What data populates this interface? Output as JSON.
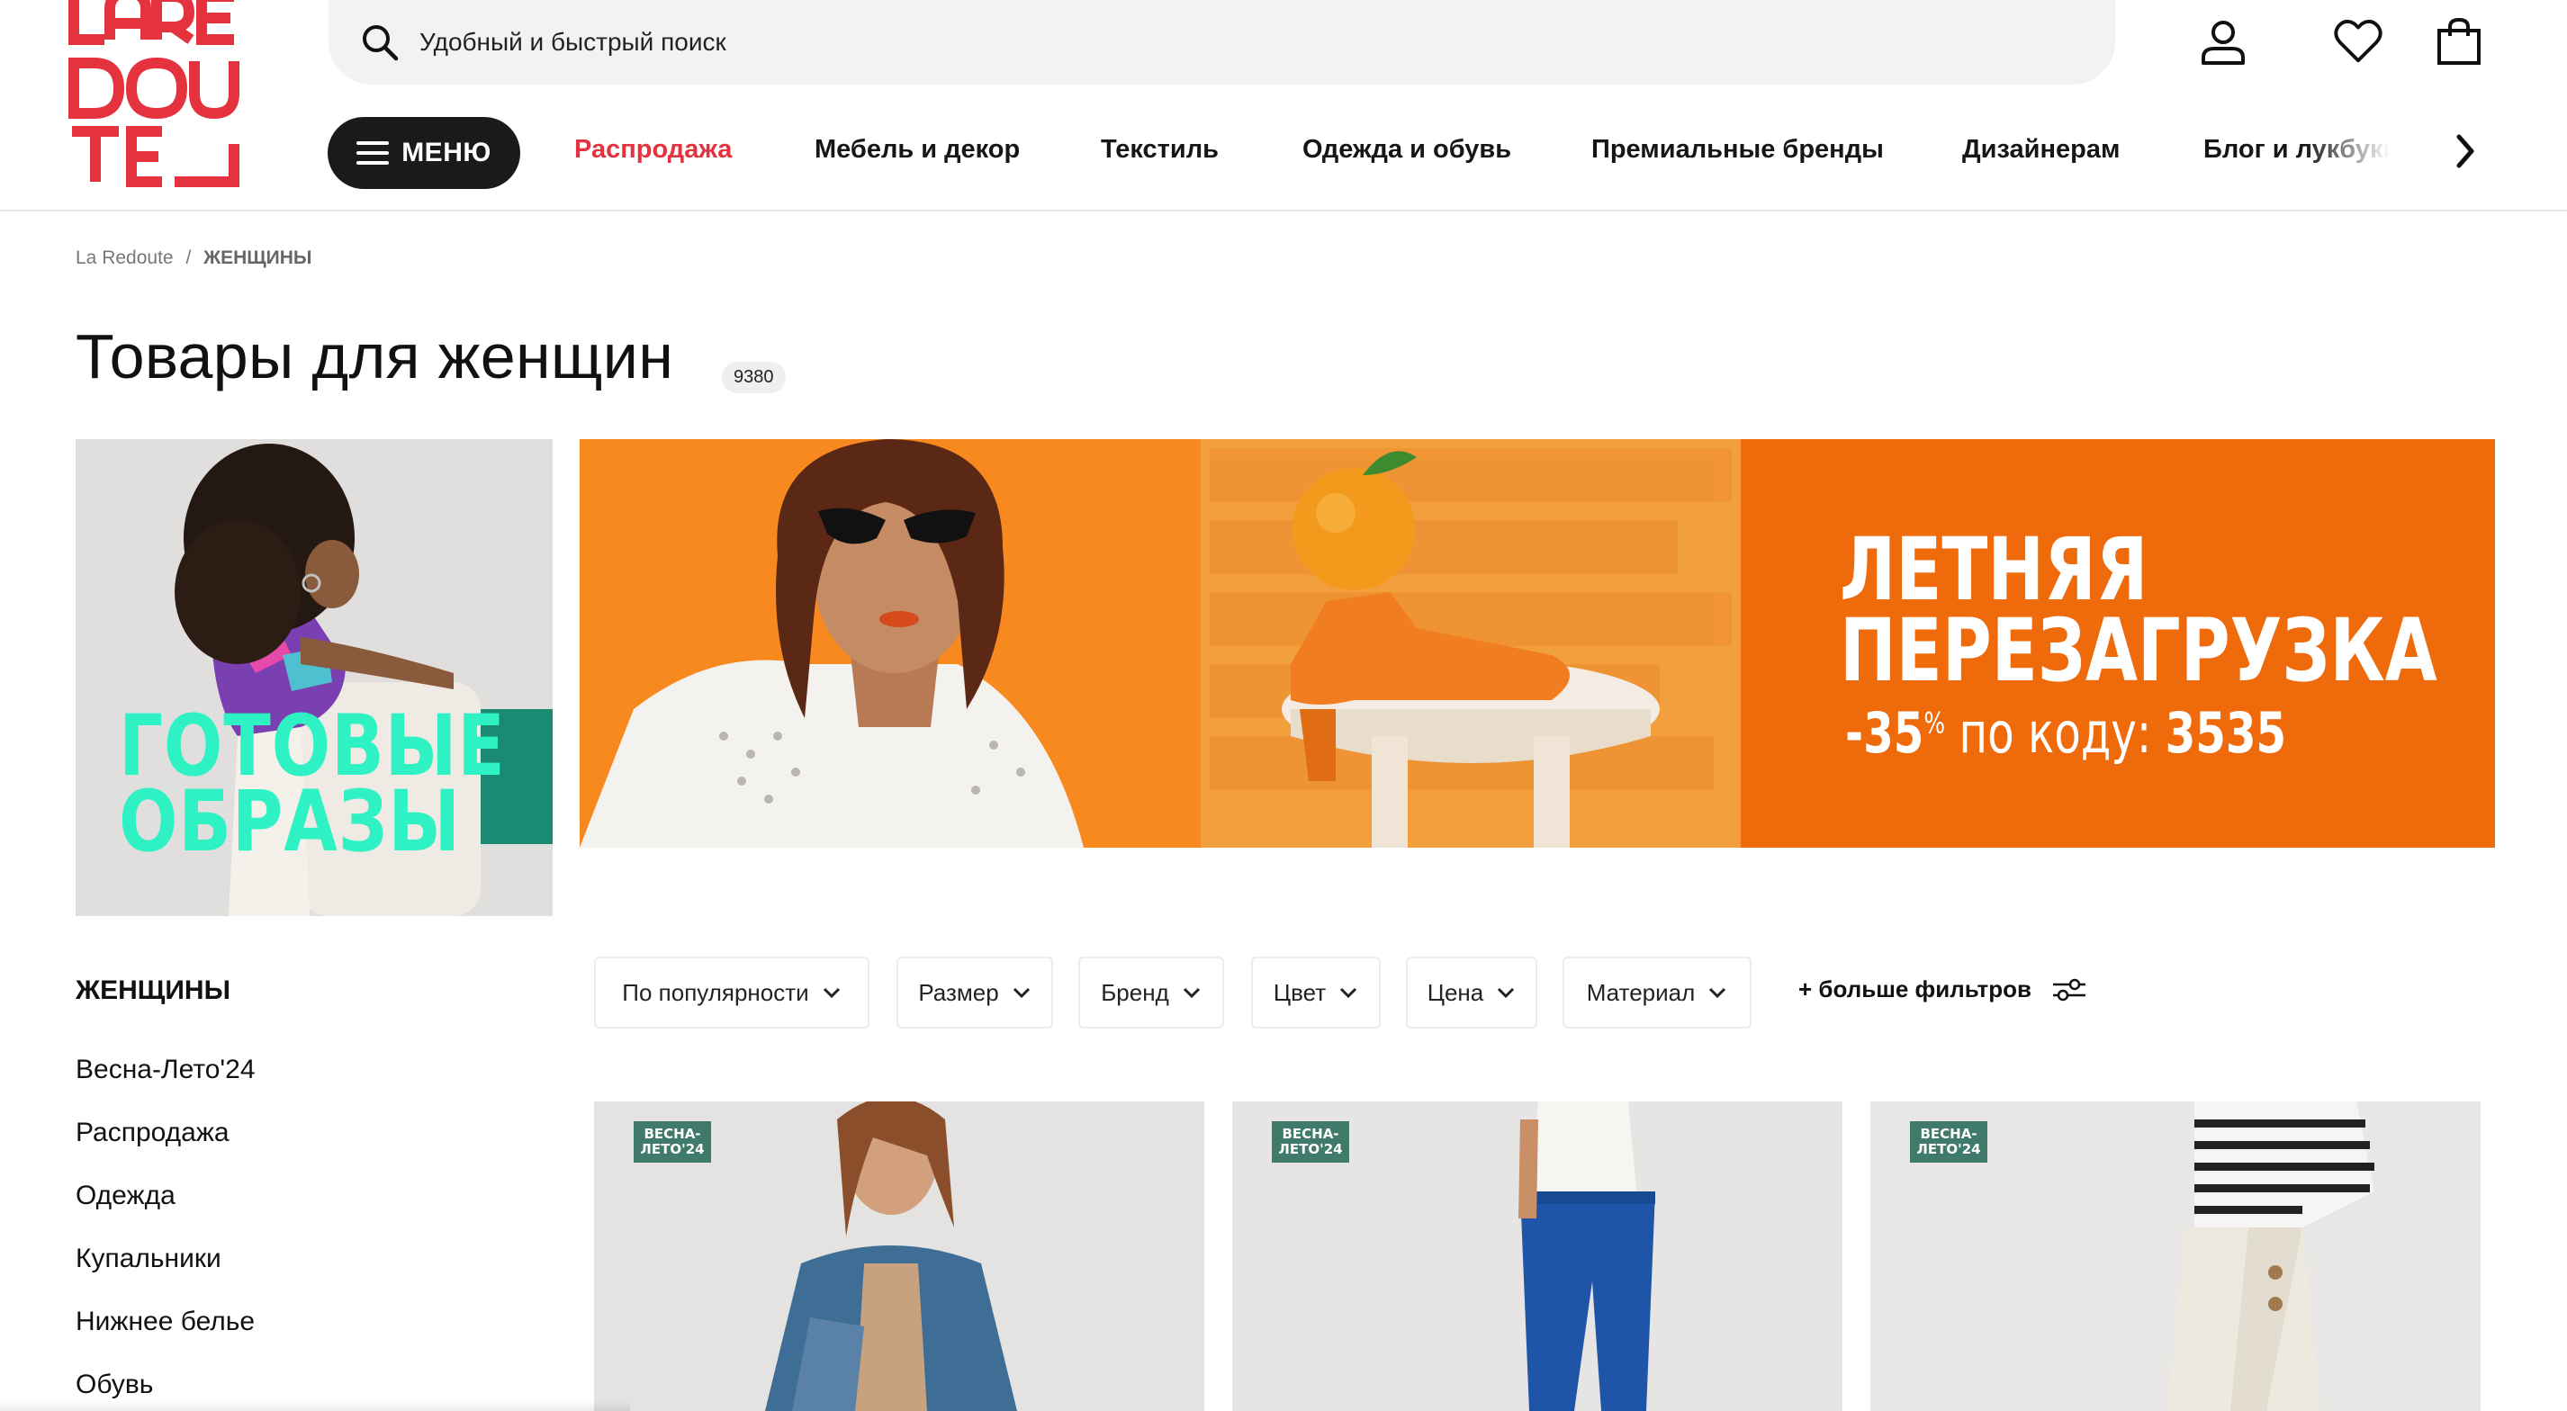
{
  "brand": {
    "logo_text": "LAREDOUTE",
    "accent_color": "#e4333f"
  },
  "search": {
    "placeholder": "Удобный и быстрый поиск"
  },
  "header_icons": [
    "account-icon",
    "heart-icon",
    "bag-icon"
  ],
  "nav": {
    "menu_label": "МЕНЮ",
    "items": [
      {
        "label": "Распродажа",
        "color": "#e4333f"
      },
      {
        "label": "Мебель и декор"
      },
      {
        "label": "Текстиль"
      },
      {
        "label": "Одежда и обувь"
      },
      {
        "label": "Премиальные бренды"
      },
      {
        "label": "Дизайнерам"
      },
      {
        "label": "Блог и лукбуки"
      }
    ]
  },
  "breadcrumb": {
    "root": "La Redoute",
    "separator": "/",
    "current": "ЖЕНЩИНЫ"
  },
  "page": {
    "title": "Товары для женщин",
    "count": "9380"
  },
  "banners": {
    "left": {
      "line1": "ГОТОВЫЕ",
      "line2": "ОБРАЗЫ"
    },
    "main": {
      "title_line1": "ЛЕТНЯЯ",
      "title_line2": "ПЕРЕЗАГРУЗКА",
      "discount": "-35",
      "percent": "%",
      "code_text": "по коду:",
      "code": "3535",
      "bg_colors": [
        "#f7891f",
        "#f2a03e",
        "#ef6a0a"
      ]
    }
  },
  "sidebar": {
    "title": "ЖЕНЩИНЫ",
    "items": [
      "Весна-Лето'24",
      "Распродажа",
      "Одежда",
      "Купальники",
      "Нижнее белье",
      "Обувь"
    ]
  },
  "filters": {
    "items": [
      "По популярности",
      "Размер",
      "Бренд",
      "Цвет",
      "Цена",
      "Материал"
    ],
    "more_label": "+ больше фильтров"
  },
  "products": [
    {
      "badge": "ВЕСНА-\nЛЕТО'24"
    },
    {
      "badge": "ВЕСНА-\nЛЕТО'24"
    },
    {
      "badge": "ВЕСНА-\nЛЕТО'24"
    }
  ]
}
